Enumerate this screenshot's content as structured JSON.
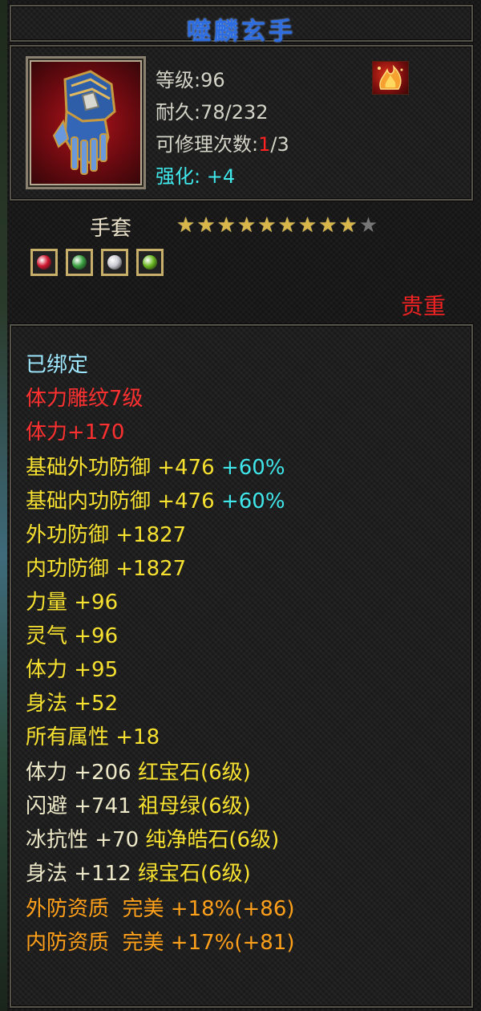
{
  "item": {
    "name": "噬麟玄手",
    "level": "等级:96",
    "durability": "耐久:78/232",
    "repair_prefix": "可修理次数:",
    "repair_used": "1",
    "repair_total": "/3",
    "enhance": "强化: +4",
    "type": "手套",
    "stars_filled": 9,
    "stars_total": 10,
    "rarity": "贵重"
  },
  "gems": [
    {
      "icon": "red-gem-icon",
      "color": "#d01830"
    },
    {
      "icon": "green-gem-icon",
      "color": "#3aa040"
    },
    {
      "icon": "white-gem-icon",
      "color": "#c8c8d0"
    },
    {
      "icon": "green-orb-icon",
      "color": "#6ab820"
    }
  ],
  "attributes": {
    "bound": "已绑定",
    "engrave": "体力雕纹7级",
    "engrave_stat": "体力+170",
    "base_outer_def": {
      "label": "基础外功防御 +476",
      "bonus": "+60%"
    },
    "base_inner_def": {
      "label": "基础内功防御 +476",
      "bonus": "+60%"
    },
    "outer_def": "外功防御 +1827",
    "inner_def": "内功防御 +1827",
    "strength": "力量 +96",
    "spirit": "灵气 +96",
    "stamina": "体力 +95",
    "agility": "身法 +52",
    "all_attr": "所有属性 +18",
    "gem_stats": [
      {
        "stat": "体力 +206",
        "gem": "红宝石(6级)"
      },
      {
        "stat": "闪避 +741",
        "gem": "祖母绿(6级)"
      },
      {
        "stat": "冰抗性 +70",
        "gem": "纯净皓石(6级)"
      },
      {
        "stat": "身法 +112",
        "gem": "绿宝石(6级)"
      }
    ],
    "quality": [
      {
        "text": "外防资质  完美 +18%(+86)"
      },
      {
        "text": "内防资质  完美 +17%(+81)"
      }
    ]
  },
  "colors": {
    "title": "#2d6de0",
    "enhance": "#3fe6ea",
    "rarity": "#ee2222",
    "bonus": "#3fe6ea",
    "yellow_stat": "#f6e030",
    "orange_quality": "#ffa01a"
  }
}
